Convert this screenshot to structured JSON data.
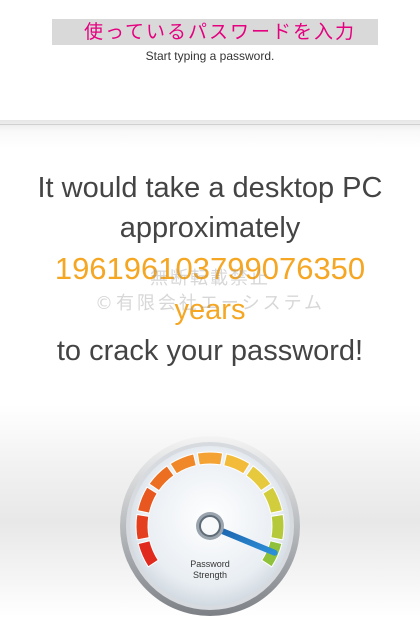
{
  "password_field": {
    "value": "使っているパスワードを入力"
  },
  "hint": {
    "text": "Start typing a password."
  },
  "result": {
    "line1": "It would take a desktop PC",
    "line2": "approximately",
    "duration_value": "1961961037990763 50",
    "duration_unit": "years",
    "line5": "to crack your password!"
  },
  "watermark": {
    "line1": "無断転載禁止",
    "line2": "©有限会社エーシステム"
  },
  "gauge": {
    "label_line1": "Password",
    "label_line2": "Strength",
    "strength_level": 0.95
  },
  "colors": {
    "accent": "#f5a623",
    "password_text": "#e4007f",
    "gauge_segments": [
      "#e02a1e",
      "#e4401f",
      "#e8571f",
      "#ec6e21",
      "#f0882a",
      "#f3a233",
      "#f2bc3a",
      "#e6c93c",
      "#d1cd3d",
      "#b5c93a",
      "#8fc23a"
    ]
  }
}
